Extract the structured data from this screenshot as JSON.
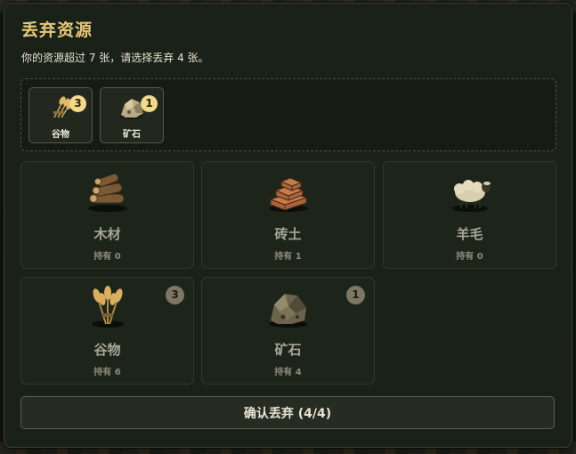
{
  "dialog": {
    "title": "丢弃资源",
    "subtitle": "你的资源超过 7 张，请选择丢弃 4 张。"
  },
  "selected": [
    {
      "label": "谷物",
      "count": "3",
      "icon": "wheat-icon"
    },
    {
      "label": "矿石",
      "count": "1",
      "icon": "ore-icon"
    }
  ],
  "resources": [
    {
      "name": "木材",
      "held": "持有 0",
      "icon": "lumber-icon",
      "discard": ""
    },
    {
      "name": "砖土",
      "held": "持有 1",
      "icon": "brick-icon",
      "discard": ""
    },
    {
      "name": "羊毛",
      "held": "持有 0",
      "icon": "sheep-icon",
      "discard": ""
    },
    {
      "name": "谷物",
      "held": "持有 6",
      "icon": "wheat-icon",
      "discard": "3"
    },
    {
      "name": "矿石",
      "held": "持有 4",
      "icon": "ore-icon",
      "discard": "1"
    }
  ],
  "confirm_label": "确认丢弃 (4/4)",
  "colors": {
    "title": "#e8c77a",
    "badge_selected": "#f2d98c",
    "badge_card": "#7d7663",
    "panel": "#1a2118"
  }
}
